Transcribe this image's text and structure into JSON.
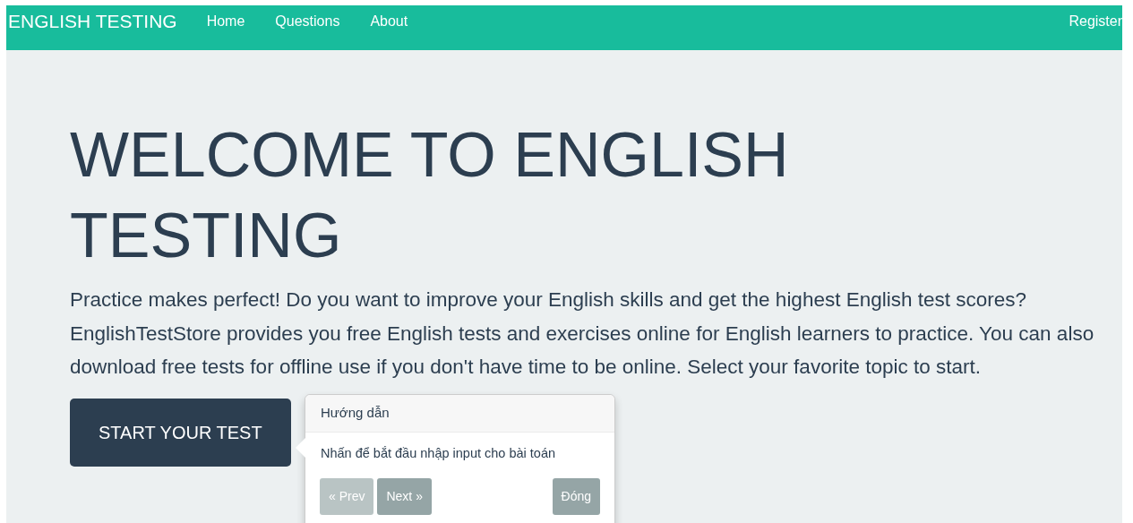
{
  "navbar": {
    "brand": "ENGLISH TESTING",
    "links": [
      {
        "label": "Home",
        "selected": false
      },
      {
        "label": "Questions",
        "selected": false
      },
      {
        "label": "About",
        "selected": false
      }
    ],
    "right_link": "Register"
  },
  "hero": {
    "title": "WELCOME TO ENGLISH TESTING",
    "text": "Practice makes perfect! Do you want to improve your English skills and get the highest English test scores? EnglishTestStore provides you free English tests and exercises online for English learners to practice. You can also download free tests for offline use if you don't have time to be online. Select your favorite topic to start.",
    "button": "START YOUR TEST"
  },
  "tour_popover": {
    "title": "Hướng dẫn",
    "content": "Nhấn để bắt đầu nhập input cho bài toán",
    "buttons": [
      {
        "kind": "prev",
        "label": "« Prev",
        "disabled": true
      },
      {
        "kind": "next",
        "label": "Next »",
        "disabled": false
      },
      {
        "kind": "close",
        "label": "Đóng",
        "disabled": false
      }
    ]
  }
}
